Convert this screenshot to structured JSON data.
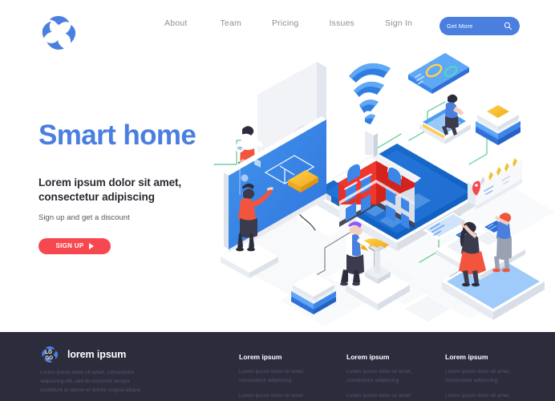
{
  "brand": {
    "logo_top": "LO",
    "logo_bottom": "GO",
    "accent_blue": "#4a7fe0",
    "accent_red": "#f8484f",
    "footer_bg": "#2c2c3c"
  },
  "header": {
    "logo_name": "LOGO",
    "nav": [
      {
        "label": "About"
      },
      {
        "label": "Team"
      },
      {
        "label": "Pricing"
      },
      {
        "label": "Issues"
      },
      {
        "label": "Sign In"
      }
    ],
    "cta": {
      "label": "Get More",
      "icon": "search-icon"
    }
  },
  "hero": {
    "title": "Smart home",
    "subtitle": "Lorem ipsum dolor sit amet, consectetur adipiscing",
    "note": "Sign up and get a discount",
    "button": {
      "label": "SIGN UP",
      "icon": "play-triangle-icon"
    }
  },
  "illustration": {
    "alt": "Isometric smart home scene",
    "objects": [
      "wifi-signal-icon",
      "dashboard-card",
      "smart-house",
      "blue-tablet-platform",
      "floorplan-screen",
      "white-monitor-panel",
      "review-card",
      "server-stack",
      "laptop-desk",
      "engineer-with-key",
      "people"
    ]
  },
  "footer": {
    "logo_top": "LO",
    "logo_bottom": "GO",
    "brand_name": "lorem ipsum",
    "about": "Lorem ipsum dolor sit amet, consectetur adipiscing elit, sed do eiusmod tempor incididunt ut labore et dolore magna aliqua.",
    "columns": [
      {
        "title": "Lorem ipsum",
        "items": [
          "Lorem ipsum dolor sit amet, consectetur adipiscing",
          "Lorem ipsum dolor sit amet"
        ]
      },
      {
        "title": "Lorem ipsum",
        "items": [
          "Lorem ipsum dolor sit amet, consectetur adipiscing",
          "Lorem ipsum dolor sit amet"
        ]
      },
      {
        "title": "Lorem ipsum",
        "items": [
          "Lorem ipsum dolor sit amet, consectetur adipiscing",
          "Lorem ipsum dolor sit amet"
        ]
      }
    ]
  }
}
